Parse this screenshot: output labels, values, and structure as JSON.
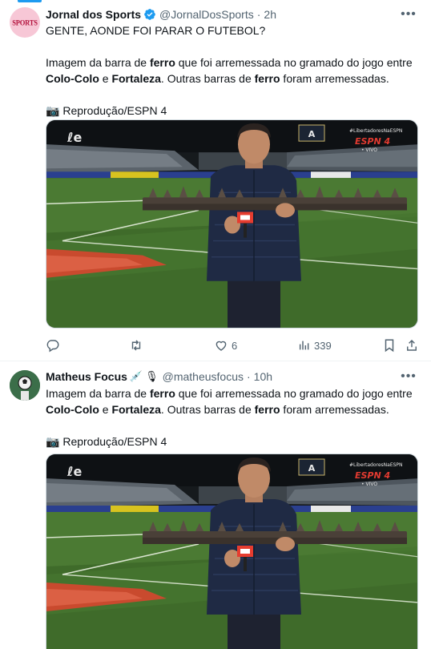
{
  "tweets": [
    {
      "display_name": "Jornal dos Sports",
      "handle": "@JornalDosSports",
      "separator": "·",
      "time": "2h",
      "avatar_text": "SPORTS",
      "verified": true,
      "headline": "GENTE, AONDE FOI PARAR O FUTEBOL?",
      "text": {
        "l1_a": "Imagem da barra de ",
        "l1_b": "ferro",
        "l1_c": " que foi arremessada no gramado do jogo entre",
        "l2_a": "Colo-Colo",
        "l2_b": " e ",
        "l2_c": "Fortaleza",
        "l2_d": ". Outras barras de ",
        "l2_e": "ferro",
        "l2_f": " foram arremessadas.",
        "credit": "Reprodução/ESPN 4"
      },
      "media": {
        "hashtag": "#LibertadoresNaESPN",
        "network": "ESPN 4",
        "live": "• VIVO"
      },
      "actions": {
        "reply_count": "",
        "repost_count": "",
        "like_count": "6",
        "views_count": "339"
      }
    },
    {
      "display_name": "Matheus Focus",
      "handle": "@matheusfocus",
      "separator": "·",
      "time": "10h",
      "text": {
        "l1_a": "Imagem da barra de ",
        "l1_b": "ferro",
        "l1_c": " que foi arremessada no gramado do jogo entre",
        "l2_a": "Colo-Colo",
        "l2_b": " e ",
        "l2_c": "Fortaleza",
        "l2_d": ". Outras barras de ",
        "l2_e": "ferro",
        "l2_f": " foram arremessadas.",
        "credit": "Reprodução/ESPN 4"
      },
      "media": {
        "hashtag": "#LibertadoresNaESPN",
        "network": "ESPN 4",
        "live": "• VIVO"
      }
    }
  ],
  "colors": {
    "text_primary": "#0f1419",
    "text_secondary": "#536471",
    "verified_blue": "#1d9bf0",
    "divider": "#eff3f4"
  },
  "icons": [
    "verified-badge-icon",
    "more-icon",
    "reply-icon",
    "repost-icon",
    "like-icon",
    "views-icon",
    "bookmark-icon",
    "share-icon",
    "camera-emoji-icon",
    "syringe-emoji-icon",
    "microphone-emoji-icon"
  ]
}
